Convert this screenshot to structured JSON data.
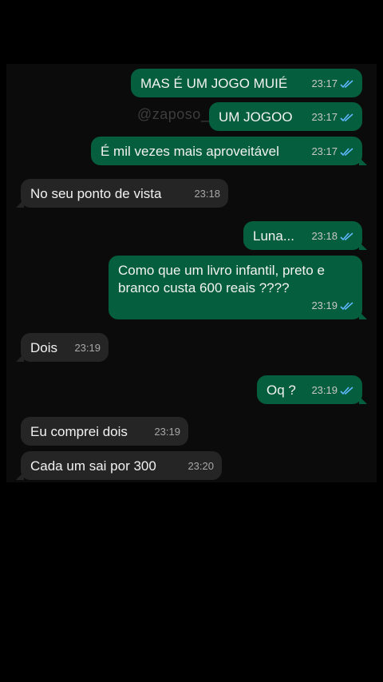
{
  "watermark": "@zaposo_úm",
  "colors": {
    "outgoing_bubble": "#055e3d",
    "incoming_bubble": "#252525",
    "read_ticks": "#5fb7ff",
    "chat_background": "#0b0b0b"
  },
  "messages": [
    {
      "dir": "out",
      "text": "MAS É UM JOGO MUIÉ",
      "time": "23:17",
      "status": "read"
    },
    {
      "dir": "out",
      "text": "UM JOGOO",
      "time": "23:17",
      "status": "read"
    },
    {
      "dir": "out",
      "text": "É mil vezes mais aproveitável",
      "time": "23:17",
      "status": "read"
    },
    {
      "dir": "in",
      "text": "No seu ponto de vista",
      "time": "23:18"
    },
    {
      "dir": "out",
      "text": "Luna...",
      "time": "23:18",
      "status": "read"
    },
    {
      "dir": "out",
      "text": "Como que um livro infantil, preto e branco custa 600 reais ????",
      "time": "23:19",
      "status": "read"
    },
    {
      "dir": "in",
      "text": "Dois",
      "time": "23:19"
    },
    {
      "dir": "out",
      "text": "Oq ?",
      "time": "23:19",
      "status": "read"
    },
    {
      "dir": "in",
      "text": "Eu comprei dois",
      "time": "23:19"
    },
    {
      "dir": "in",
      "text": "Cada um sai por 300",
      "time": "23:20"
    }
  ]
}
